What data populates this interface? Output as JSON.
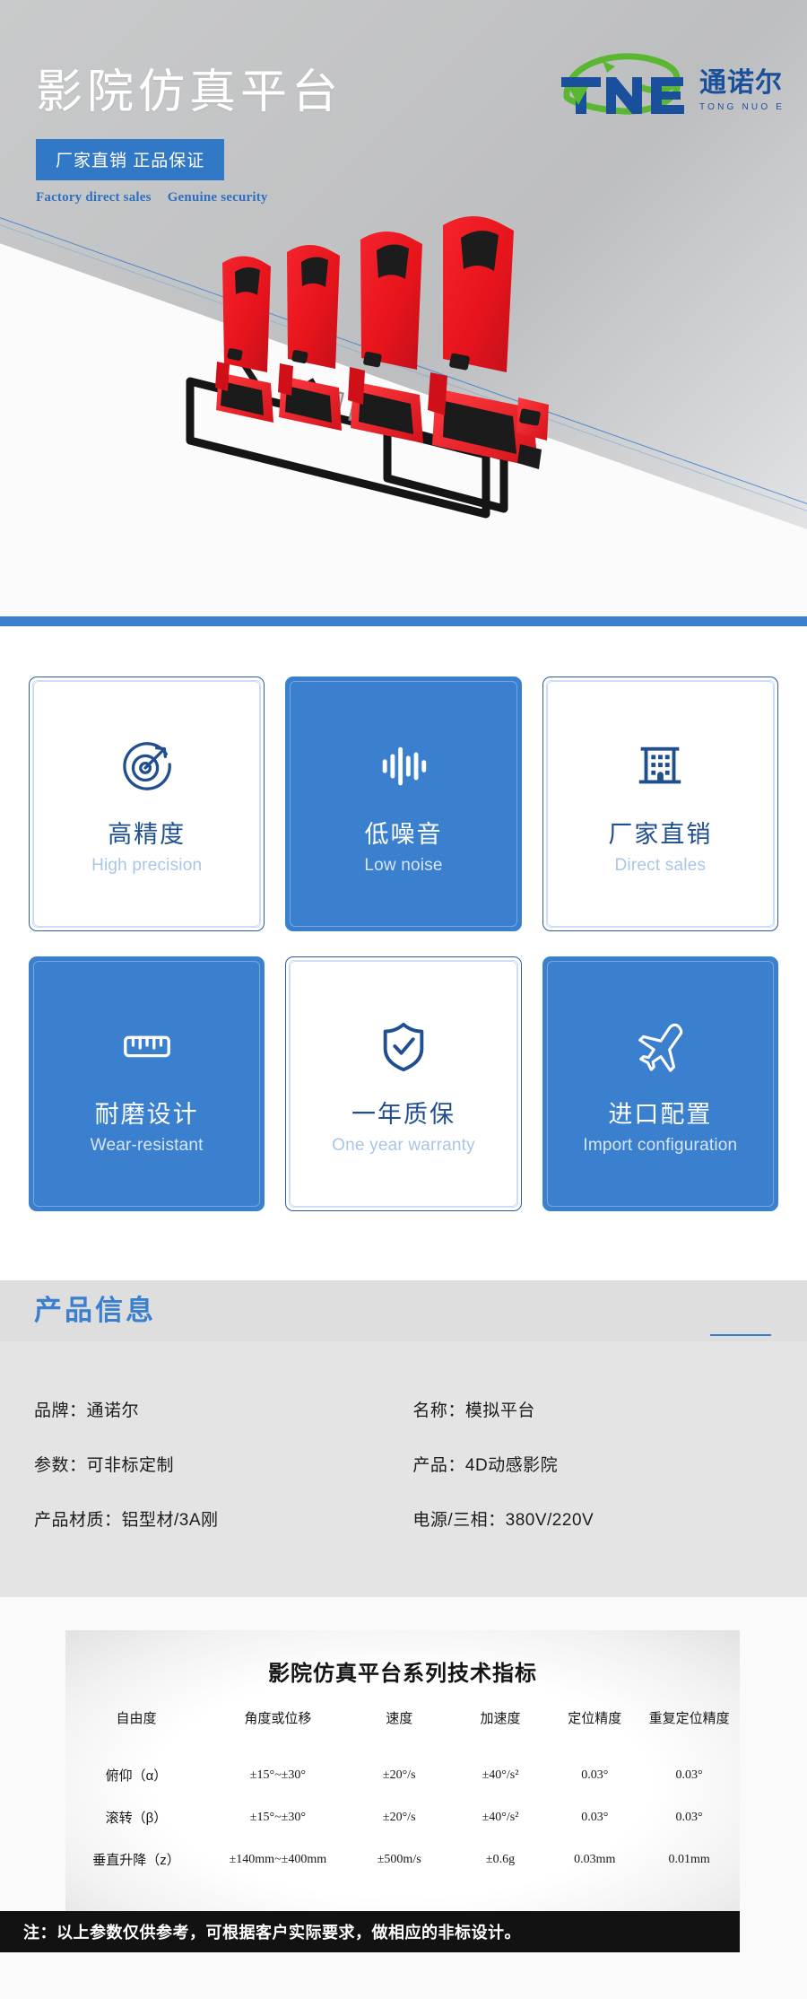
{
  "hero": {
    "title": "影院仿真平台",
    "badge": "厂家直销  正品保证",
    "sub_left": "Factory direct sales",
    "sub_right": "Genuine security",
    "logo": {
      "mark": "TNE",
      "brand_cn": "通诺尔",
      "brand_pinyin": "TONG NUO ER",
      "green": "#5bb731",
      "blue": "#1a4f9c"
    },
    "product_image_alt": "4D 影院动感座椅 四连座 平台"
  },
  "divider_color": "#3b80cf",
  "features": [
    {
      "icon": "target-arrow-icon",
      "cn": "高精度",
      "en": "High precision",
      "style": "white"
    },
    {
      "icon": "sound-wave-icon",
      "cn": "低噪音",
      "en": "Low noise",
      "style": "blue"
    },
    {
      "icon": "factory-building-icon",
      "cn": "厂家直销",
      "en": "Direct sales",
      "style": "white"
    },
    {
      "icon": "ruler-icon",
      "cn": "耐磨设计",
      "en": "Wear-resistant",
      "style": "blue"
    },
    {
      "icon": "shield-check-icon",
      "cn": "一年质保",
      "en": "One year warranty",
      "style": "white"
    },
    {
      "icon": "airplane-icon",
      "cn": "进口配置",
      "en": "Import configuration",
      "style": "blue"
    }
  ],
  "product_info": {
    "heading": "产品信息",
    "rows": [
      "品牌：通诺尔",
      "名称：模拟平台",
      "参数：可非标定制",
      "产品：4D动感影院",
      "产品材质：铝型材/3A刚",
      "电源/三相：380V/220V"
    ]
  },
  "spec_table": {
    "title": "影院仿真平台系列技术指标",
    "headers": [
      "自由度",
      "角度或位移",
      "速度",
      "加速度",
      "定位精度",
      "重复定位精度"
    ],
    "rows": [
      [
        "俯仰（α）",
        "±15°~±30°",
        "±20°/s",
        "±40°/s²",
        "0.03°",
        "0.03°"
      ],
      [
        "滚转（β）",
        "±15°~±30°",
        "±20°/s",
        "±40°/s²",
        "0.03°",
        "0.03°"
      ],
      [
        "垂直升降（z）",
        "±140mm~±400mm",
        "±500m/s",
        "±0.6g",
        "0.03mm",
        "0.01mm"
      ]
    ],
    "note": "注：以上参数仅供参考，可根据客户实际要求，做相应的非标设计。"
  }
}
